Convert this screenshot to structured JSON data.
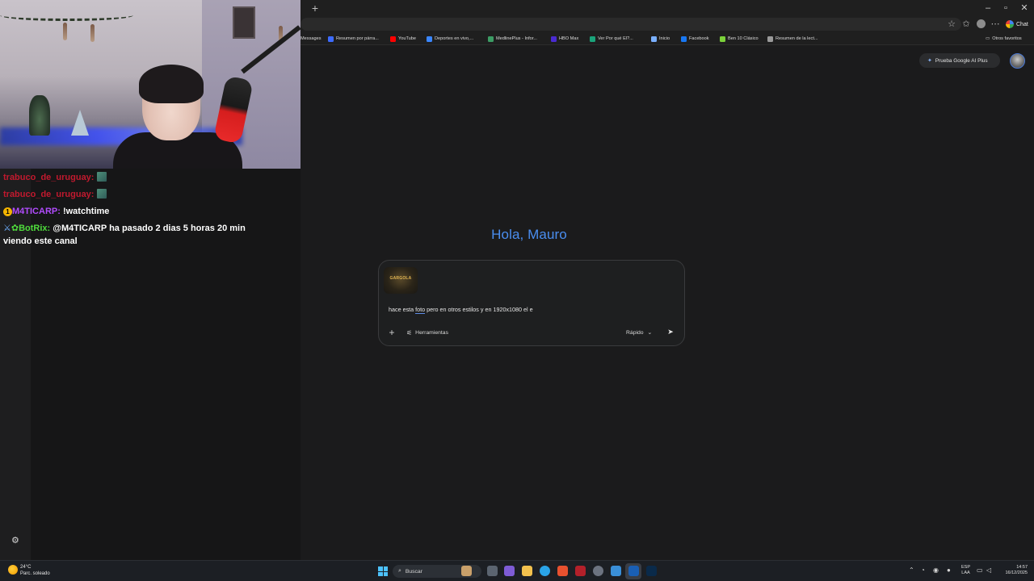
{
  "browser": {
    "chat_label": "Chat",
    "bookmarks": [
      {
        "label": "Messages",
        "color": "#6a5cff"
      },
      {
        "label": "Resumen por párra...",
        "color": "#3d6bff"
      },
      {
        "label": "YouTube",
        "color": "#ff0000"
      },
      {
        "label": "Deportes en vivo,...",
        "color": "#3a86ff"
      },
      {
        "label": "MedlinePlus - Infor...",
        "color": "#3c9c64"
      },
      {
        "label": "HBO Max",
        "color": "#4a2bd1"
      },
      {
        "label": "Ver Por qué El?...",
        "color": "#1aa37a"
      },
      {
        "label": "Inicio",
        "color": "#7ab0ff"
      },
      {
        "label": "Facebook",
        "color": "#1877f2"
      },
      {
        "label": "Ben 10 Clásico",
        "color": "#7bd13a"
      },
      {
        "label": "Resumen de la lect...",
        "color": "#9a9a9a"
      }
    ],
    "other_bookmarks": "Otros favoritos"
  },
  "page": {
    "promo_label": "Prueba Google AI Plus",
    "greeting": "Hola, Mauro",
    "composer": {
      "prompt_before": "hace esta ",
      "prompt_word": "foto",
      "prompt_after": " pero en otros estilos y en 1920x1080 el e",
      "tools_label": "Herramientas",
      "mode_label": "Rápido"
    },
    "attachment_logo_text": "GARGOLA"
  },
  "stream_chat": {
    "messages": [
      {
        "user": "trabuco_de_uruguay:",
        "text": ""
      },
      {
        "user": "trabuco_de_uruguay:",
        "text": ""
      },
      {
        "user": "M4TICARP:",
        "text": "!watchtime"
      },
      {
        "user": "BotRix:",
        "text": "@M4TICARP ha pasado 2 dias 5 horas 20 min",
        "text2": "viendo este canal"
      }
    ]
  },
  "taskbar": {
    "weather_temp": "24°C",
    "weather_desc": "Parc. soleado",
    "search_placeholder": "Buscar",
    "lang_top": "ESP",
    "lang_bottom": "LAA",
    "time": "14:57",
    "date": "16/12/2025"
  }
}
